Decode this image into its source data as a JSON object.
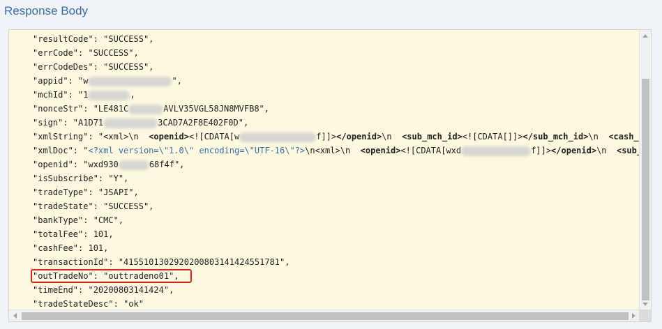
{
  "title": "Response Body",
  "lines": [
    {
      "k": "\"resultCode\"",
      "v": ": \"SUCCESS\","
    },
    {
      "k": "\"errCode\"",
      "v": ": \"SUCCESS\","
    },
    {
      "k": "\"errCodeDes\"",
      "v": ": \"SUCCESS\","
    },
    {
      "k": "\"appid\"",
      "v": ": \"w"
    },
    {
      "k": "\"mchId\"",
      "v": ": \"1"
    },
    {
      "k": "\"nonceStr\"",
      "v": ": \"LE481C"
    },
    {
      "k": "\"sign\"",
      "v": ": \"A1D71"
    },
    {
      "k": "\"xmlString\"",
      "v": ": \"<xml>\\n  "
    },
    {
      "k": "\"xmlDoc\"",
      "v": ": \""
    },
    {
      "k": "\"openid\"",
      "v": ": \"wxd930"
    },
    {
      "k": "\"isSubscribe\"",
      "v": ": \"Y\","
    },
    {
      "k": "\"tradeType\"",
      "v": ": \"JSAPI\","
    },
    {
      "k": "\"tradeState\"",
      "v": ": \"SUCCESS\","
    },
    {
      "k": "\"bankType\"",
      "v": ": \"CMC\","
    },
    {
      "k": "\"totalFee\"",
      "v": ": 101,"
    },
    {
      "k": "\"cashFee\"",
      "v": ": 101,"
    },
    {
      "k": "\"transactionId\"",
      "v": ": \"4155101302920200803141424551781\","
    },
    {
      "k": "\"outTradeNo\"",
      "v": ": \"outtradeno01\","
    },
    {
      "k": "\"timeEnd\"",
      "v": ": \"20200803141424\","
    },
    {
      "k": "\"tradeStateDesc\"",
      "v": ": \"ok\""
    }
  ],
  "fragments": {
    "appid_tail": "\",",
    "mchid_tail": ",",
    "nonce_tail": "AVLV35VGL58JN8MVFB8\",",
    "sign_tail": "3CAD7A2F8E402F0D\",",
    "openid_tail": "68f4f\",",
    "xmlstring_1": "<openid>",
    "xmlstring_2": "<![CDATA[w",
    "xmlstring_3": "f]]>",
    "xmlstring_4": "</openid>",
    "xmlstring_5": "\\n  ",
    "xmlstring_6": "<sub_mch_id>",
    "xmlstring_7": "<![CDATA[]]>",
    "xmlstring_8": "</sub_mch_id>",
    "xmlstring_9": "\\n  ",
    "xmlstring_10": "<cash_fe",
    "xmldoc_decl": "<?xml version=\\\"1.0\\\" encoding=\\\"UTF-16\\\"?>",
    "xmldoc_1": "\\n<xml>\\n  ",
    "xmldoc_2": "<openid>",
    "xmldoc_3": "<![CDATA[wxd",
    "xmldoc_4": "f]]>",
    "xmldoc_5": "</openid>",
    "xmldoc_6": "\\n  ",
    "xmldoc_7": "<sub_mc"
  }
}
